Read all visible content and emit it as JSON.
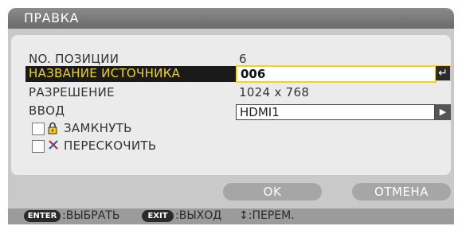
{
  "dialog": {
    "title": "ПРАВКА"
  },
  "fields": {
    "position_label": "NO. ПОЗИЦИИ",
    "position_value": "6",
    "source_name_label": "НАЗВАНИЕ ИСТОЧНИКА",
    "source_name_value": "006",
    "resolution_label": "РАЗРЕШЕНИЕ",
    "resolution_value": "1024 x 768",
    "input_label": "ВВОД",
    "input_value": "HDMI1"
  },
  "options": {
    "lock_label": "ЗАМКНУТЬ",
    "lock_checked": false,
    "skip_label": "ПЕРЕСКОЧИТЬ",
    "skip_checked": false
  },
  "buttons": {
    "ok": "OK",
    "cancel": "ОТМЕНА"
  },
  "footer": {
    "enter_key": "ENTER",
    "enter_action": ":ВЫБРАТЬ",
    "exit_key": "EXIT",
    "exit_action": ":ВЫХОД",
    "move_action": "↕:ПЕРЕМ."
  },
  "colors": {
    "highlight_text": "#f2d31b",
    "highlight_bg": "#1a1a1a",
    "title_bar": "#7a7a7a"
  },
  "icons": {
    "enter": "return-arrow-icon",
    "select": "play-triangle-icon",
    "lock": "padlock-icon",
    "skip": "skip-cross-icon"
  }
}
